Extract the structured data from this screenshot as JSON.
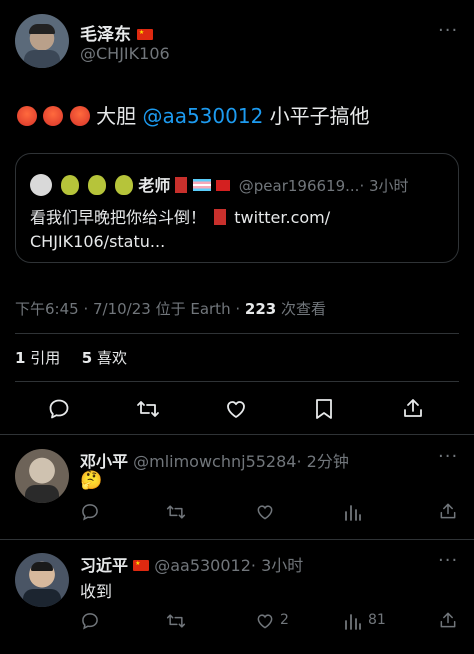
{
  "post": {
    "author_name": "毛泽东",
    "author_handle": "@CHJIK106",
    "text_prefix": "大胆",
    "mention": "@aa530012",
    "text_suffix": "小平子搞他",
    "emojis": [
      "angry-face",
      "angry-face",
      "angry-face"
    ],
    "more_icon": "more-dots-icon"
  },
  "quote": {
    "author_name": "老师",
    "author_handle": "@pear196619...",
    "time": "· 3小时",
    "text_line1": "看我们早晚把你给斗倒！",
    "link_line1": "twitter.com/",
    "link_line2": "CHJIK106/statu..."
  },
  "meta": {
    "time_date": "下午6:45 · 7/10/23 位于 Earth ·",
    "views_count": "223",
    "views_label": "次查看"
  },
  "stats": {
    "quotes_count": "1",
    "quotes_label": "引用",
    "likes_count": "5",
    "likes_label": "喜欢"
  },
  "replies": [
    {
      "author_name": "邓小平",
      "author_handle": "@mlimowchnj55284",
      "time": "· 2分钟",
      "text": "🤔",
      "likes": "",
      "views": ""
    },
    {
      "author_name": "习近平",
      "author_handle": "@aa530012",
      "time": "· 3小时",
      "text": "收到",
      "likes": "2",
      "views": "81"
    }
  ],
  "colors": {
    "background": "#000000",
    "accent": "#1d9bf0",
    "muted": "#71767b",
    "divider": "#2f3336"
  }
}
